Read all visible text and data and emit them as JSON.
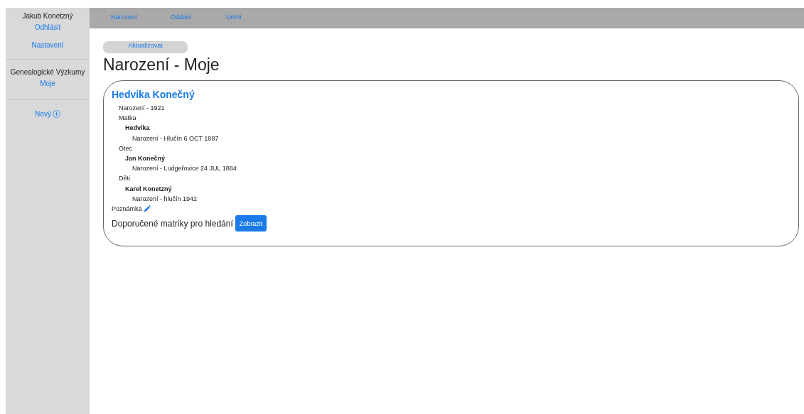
{
  "sidebar": {
    "user": "Jakub Konetzný",
    "links": [
      {
        "label": "Odhlásit"
      },
      {
        "label": "Nastavení"
      }
    ],
    "section_title": "Genealogické Výzkumy",
    "section_items": [
      {
        "label": "Moje"
      }
    ],
    "new_label": "Nový"
  },
  "nav": {
    "tabs": [
      {
        "label": "Narození"
      },
      {
        "label": "Oddaní"
      },
      {
        "label": "Umrti"
      }
    ]
  },
  "update_button": "Aktualizovat",
  "heading": "Narození - Moje",
  "record": {
    "name": "Hedvika Konečný",
    "birth": "Narození - 1921",
    "sections": [
      {
        "title": "Matka",
        "children": [
          {
            "name": "Hedvika",
            "birth": "Narození - Hlučín 6 OCT 1887"
          }
        ]
      },
      {
        "title": "Otec",
        "children": [
          {
            "name": "Jan Konečný",
            "birth": "Narození - Ludgeřovice 24 JUL 1884"
          }
        ]
      },
      {
        "title": "Děti",
        "children": [
          {
            "name": "Karel Konetzný",
            "birth": "Narození - hlučín 1942"
          }
        ]
      }
    ],
    "note_label": "Poznámka",
    "recommend_label": "Doporučené matriky pro hledání",
    "show_button": "Zobrazit"
  }
}
